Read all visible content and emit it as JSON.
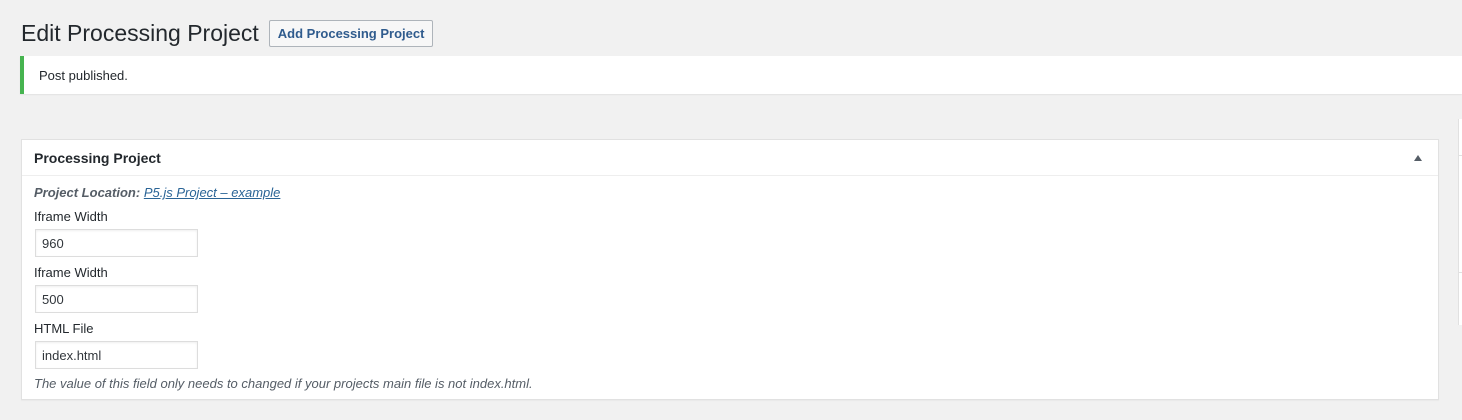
{
  "header": {
    "title": "Edit Processing Project",
    "add_button_label": "Add Processing Project"
  },
  "notice": {
    "text": "Post published.",
    "accent_color": "#46b450"
  },
  "metabox": {
    "title": "Processing Project",
    "toggle_icon": "triangle-up-icon",
    "project_location_label": "Project Location:",
    "project_location_link": "P5.js Project – example",
    "fields": [
      {
        "label": "Iframe Width",
        "value": "960"
      },
      {
        "label": "Iframe Width",
        "value": "500"
      },
      {
        "label": "HTML File",
        "value": "index.html"
      }
    ],
    "description": "The value of this field only needs to changed if your projects main file is not index.html."
  }
}
